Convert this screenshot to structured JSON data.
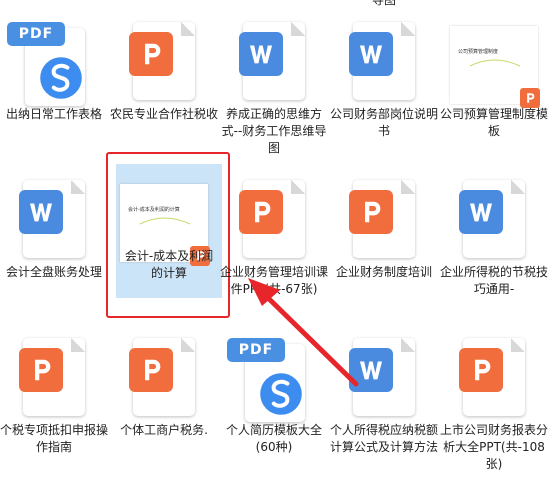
{
  "top_partial_label": "导图",
  "colors": {
    "ppt": "#f26d3d",
    "word": "#4a8be0",
    "pdf": "#4a90e2",
    "selection": "#cce4f7",
    "highlight": "#e6262a"
  },
  "files": [
    {
      "type": "pdf",
      "label": "出纳日常工作表格",
      "icon": "pdf-icon"
    },
    {
      "type": "ppt",
      "label": "农民专业合作社税收",
      "icon": "ppt-icon"
    },
    {
      "type": "word",
      "label": "养成正确的思维方式--财务工作思维导图",
      "icon": "word-icon"
    },
    {
      "type": "word",
      "label": "公司财务部岗位说明书",
      "icon": "word-icon"
    },
    {
      "type": "thumb-ppt",
      "label": "公司预算管理制度模板",
      "icon": "ppt-thumbnail",
      "thumb_text": "公司预算管理制度"
    },
    {
      "type": "word",
      "label": "会计全盘账务处理",
      "icon": "word-icon"
    },
    {
      "type": "thumb-ppt",
      "label": "会计-成本及利润的计算",
      "icon": "ppt-thumbnail",
      "thumb_text": "会计-成本及利润的计算"
    },
    {
      "type": "ppt",
      "label": "企业财务管理培训课件PPT(共-67张)",
      "icon": "ppt-icon"
    },
    {
      "type": "ppt",
      "label": "企业财务制度培训",
      "icon": "ppt-icon"
    },
    {
      "type": "word",
      "label": "企业所得税的节税技巧通用-",
      "icon": "word-icon"
    },
    {
      "type": "ppt",
      "label": "个税专项抵扣申报操作指南",
      "icon": "ppt-icon"
    },
    {
      "type": "ppt",
      "label": "个体工商户税务.",
      "icon": "ppt-icon"
    },
    {
      "type": "pdf",
      "label": "个人简历模板大全(60种)",
      "icon": "pdf-icon"
    },
    {
      "type": "word",
      "label": "个人所得税应纳税额计算公式及计算方法",
      "icon": "word-icon"
    },
    {
      "type": "ppt",
      "label": "上市公司财务报表分析大全PPT(共-108张)",
      "icon": "ppt-icon"
    }
  ],
  "pdf_tag": "PDF",
  "selected_index": 6
}
